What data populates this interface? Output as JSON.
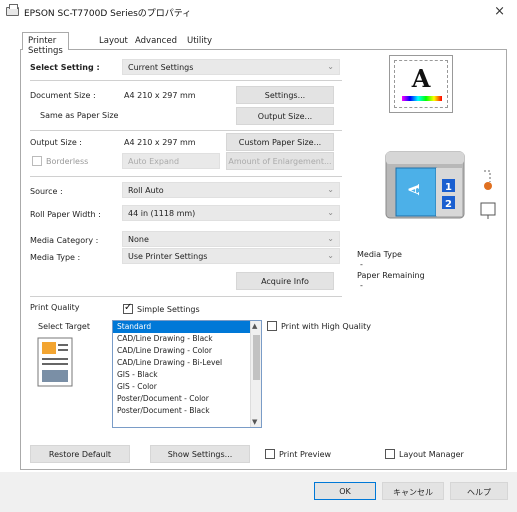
{
  "window": {
    "title": "EPSON SC-T7700D Seriesのプロパティ",
    "close": "×"
  },
  "tabs": [
    "Printer Settings",
    "Layout",
    "Advanced",
    "Utility"
  ],
  "select_setting": {
    "label": "Select Setting :",
    "value": "Current Settings"
  },
  "document_size": {
    "label": "Document Size :",
    "value": "A4 210 x 297 mm",
    "button": "Settings..."
  },
  "same_as_paper": {
    "label": "Same as Paper Size",
    "button": "Output Size..."
  },
  "output_size": {
    "label": "Output Size :",
    "value": "A4 210 x 297 mm",
    "button": "Custom Paper Size..."
  },
  "borderless": {
    "label": "Borderless",
    "value": "Auto Expand",
    "button": "Amount of Enlargement..."
  },
  "source": {
    "label": "Source :",
    "value": "Roll Auto"
  },
  "roll_width": {
    "label": "Roll Paper Width :",
    "value": "44 in (1118 mm)"
  },
  "media_category": {
    "label": "Media Category :",
    "value": "None"
  },
  "media_type": {
    "label": "Media Type :",
    "value": "Use Printer Settings"
  },
  "acquire_info": "Acquire Info",
  "printer_status": {
    "media_type_label": "Media Type",
    "media_type_value": "-",
    "paper_remaining_label": "Paper Remaining",
    "paper_remaining_value": "-"
  },
  "preview_letter": "A",
  "print_quality": {
    "label": "Print Quality",
    "simple_settings": "Simple Settings",
    "select_target": "Select Target",
    "high_quality": "Print with High Quality",
    "targets": [
      "Standard",
      "CAD/Line Drawing - Black",
      "CAD/Line Drawing - Color",
      "CAD/Line Drawing - Bi-Level",
      "GIS - Black",
      "GIS - Color",
      "Poster/Document - Color",
      "Poster/Document - Black"
    ],
    "selected_index": 0
  },
  "footer": {
    "restore": "Restore Default",
    "show_settings": "Show Settings...",
    "print_preview": "Print Preview",
    "layout_manager": "Layout Manager"
  },
  "dialog": {
    "ok": "OK",
    "cancel": "キャンセル",
    "help": "ヘルプ"
  },
  "colors": {
    "accent": "#0078d7",
    "panel_border": "#aaaaaa",
    "badge_blue": "#1a5fd0",
    "badge_orange": "#e07020"
  }
}
